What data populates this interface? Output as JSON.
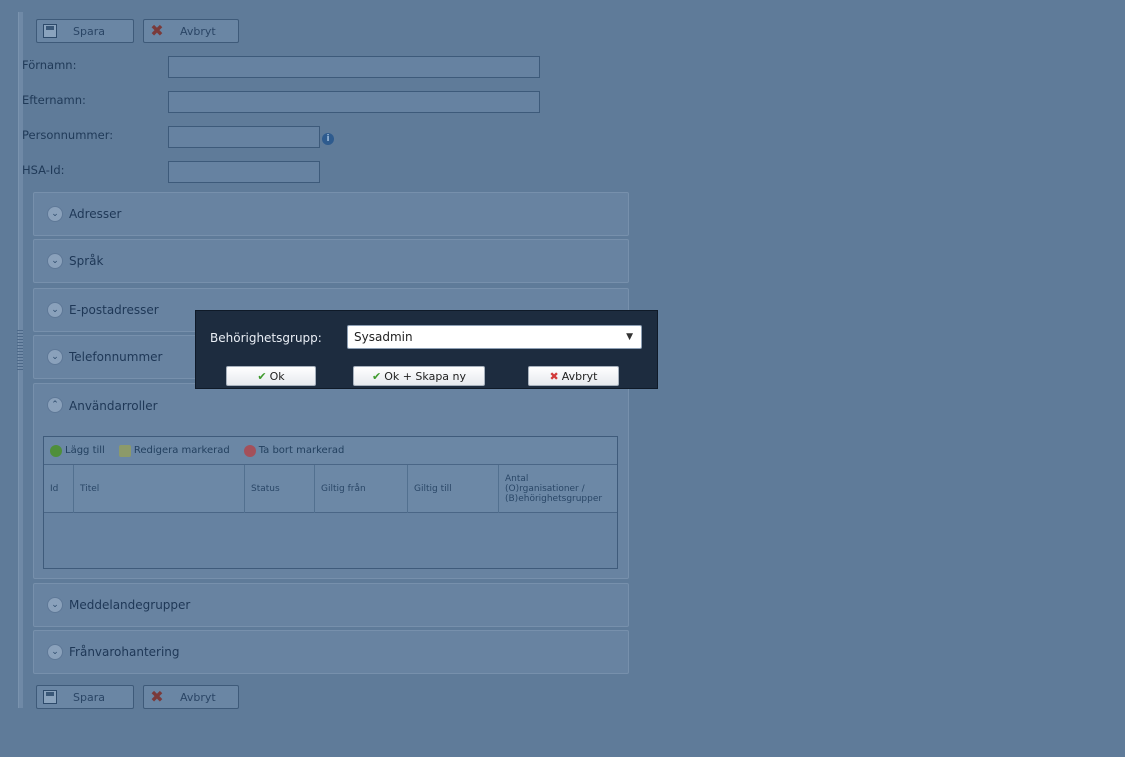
{
  "toolbar": {
    "save_label": "Spara",
    "cancel_label": "Avbryt"
  },
  "form": {
    "firstname": {
      "label": "Förnamn:",
      "value": ""
    },
    "lastname": {
      "label": "Efternamn:",
      "value": ""
    },
    "personnummer": {
      "label": "Personnummer:",
      "value": ""
    },
    "hsa": {
      "label": "HSA-Id:",
      "value": ""
    }
  },
  "sections": {
    "adresser": "Adresser",
    "sprak": "Språk",
    "epost": "E-postadresser",
    "telefon": "Telefonnummer",
    "roller": "Användarroller",
    "meddelande": "Meddelandegrupper",
    "franvaro": "Frånvarohantering"
  },
  "grid": {
    "toolbar": {
      "add": "Lägg till",
      "edit": "Redigera markerad",
      "remove": "Ta bort markerad"
    },
    "columns": {
      "id": "Id",
      "titel": "Titel",
      "status": "Status",
      "from": "Giltig från",
      "to": "Giltig till",
      "antal1": "Antal",
      "antal2": "(O)rganisationer /",
      "antal3": "(B)ehörighetsgrupper"
    }
  },
  "modal": {
    "label": "Behörighetsgrupp:",
    "selected": "Sysadmin",
    "ok": "Ok",
    "ok_new": "Ok + Skapa ny",
    "cancel": "Avbryt"
  },
  "colors": {
    "background": "#5f7b99",
    "modal_bg": "#1d2c3f",
    "check_green": "#3e9a2c",
    "cancel_red": "#d23a3a"
  }
}
